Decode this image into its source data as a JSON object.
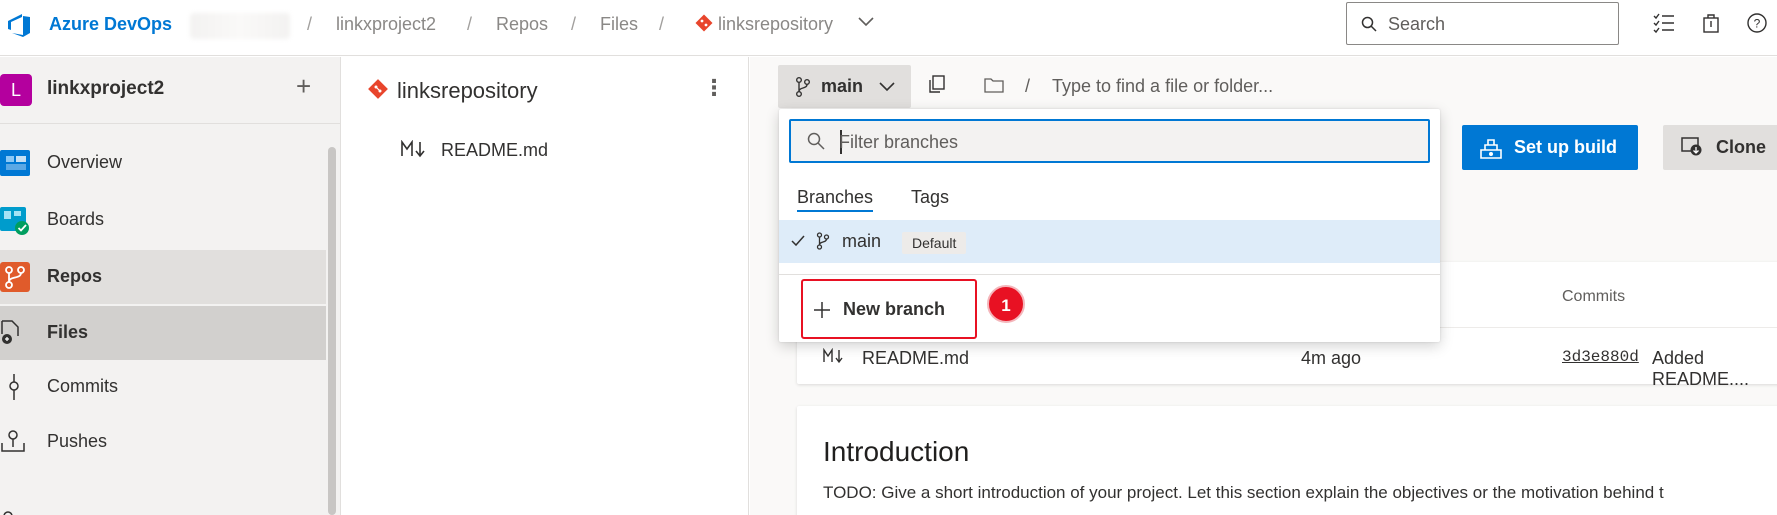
{
  "header": {
    "brand": "Azure DevOps",
    "breadcrumbs": [
      "linkxproject2",
      "Repos",
      "Files",
      "linksrepository"
    ],
    "search_placeholder": "Search"
  },
  "sidebar": {
    "project_initial": "L",
    "project_name": "linkxproject2",
    "add_label": "+",
    "items": [
      {
        "label": "Overview",
        "icon": "overview-icon"
      },
      {
        "label": "Boards",
        "icon": "boards-icon"
      },
      {
        "label": "Repos",
        "icon": "repos-icon"
      },
      {
        "label": "Files",
        "icon": "files-icon"
      },
      {
        "label": "Commits",
        "icon": "commits-icon"
      },
      {
        "label": "Pushes",
        "icon": "pushes-icon"
      }
    ]
  },
  "tree": {
    "repo_name": "linksrepository",
    "more_label": "⋮",
    "files": [
      "README.md"
    ]
  },
  "main": {
    "branch": "main",
    "path_placeholder": "Type to find a file or folder...",
    "setup_build_label": "Set up build",
    "clone_label": "Clone",
    "columns": {
      "commits": "Commits"
    },
    "rows": [
      {
        "name": "README.md",
        "age": "4m ago",
        "commit": "3d3e880d",
        "message": "Added README...."
      }
    ],
    "readme": {
      "heading": "Introduction",
      "text": "TODO: Give a short introduction of your project. Let this section explain the objectives or the motivation behind t"
    }
  },
  "dropdown": {
    "filter_placeholder": "Filter branches",
    "tabs": [
      "Branches",
      "Tags"
    ],
    "branches": [
      {
        "name": "main",
        "badge": "Default",
        "selected": true
      }
    ],
    "new_branch_label": "New branch",
    "step_number": "1"
  },
  "colors": {
    "accent": "#0078d4",
    "highlight": "#e81123",
    "repo_git": "#e8452c"
  }
}
